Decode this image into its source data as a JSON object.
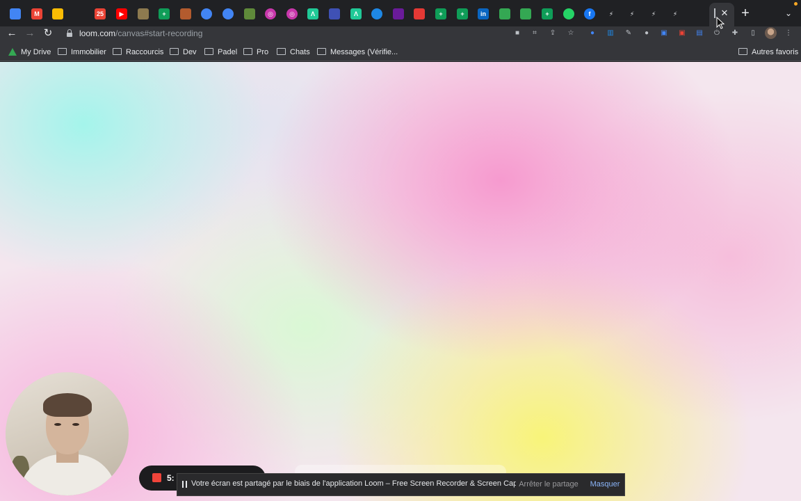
{
  "browser": {
    "tabs": [
      {
        "icon": "maps-pin-icon",
        "color": "#4285f4",
        "glyph": ""
      },
      {
        "icon": "gmail-icon",
        "color": "#ea4335",
        "glyph": "M"
      },
      {
        "icon": "drive-icon",
        "color": "#fbbc04",
        "glyph": ""
      },
      {
        "icon": "notes-icon",
        "color": "#e8eaed",
        "glyph": ""
      },
      {
        "icon": "calendar-icon",
        "color": "#ea4335",
        "glyph": "25"
      },
      {
        "icon": "youtube-icon",
        "color": "#ff0000",
        "glyph": "▶"
      },
      {
        "icon": "tool-icon",
        "color": "#8d7a4f",
        "glyph": ""
      },
      {
        "icon": "sheets-icon",
        "color": "#0f9d58",
        "glyph": "+"
      },
      {
        "icon": "football-icon",
        "color": "#b35b2e",
        "glyph": ""
      },
      {
        "icon": "calendar-blue-icon",
        "color": "#4285f4",
        "glyph": ""
      },
      {
        "icon": "calendar-blue-2-icon",
        "color": "#4285f4",
        "glyph": ""
      },
      {
        "icon": "plant-icon",
        "color": "#5f8a3a",
        "glyph": ""
      },
      {
        "icon": "target-icon",
        "color": "#c837ab",
        "glyph": "◎"
      },
      {
        "icon": "target-2-icon",
        "color": "#c837ab",
        "glyph": "◎"
      },
      {
        "icon": "lambda-icon",
        "color": "#20c997",
        "glyph": "Λ"
      },
      {
        "icon": "blue-app-icon",
        "color": "#3f51b5",
        "glyph": ""
      },
      {
        "icon": "lambda-2-icon",
        "color": "#20c997",
        "glyph": "Λ"
      },
      {
        "icon": "compass-icon",
        "color": "#1e88e5",
        "glyph": ""
      },
      {
        "icon": "stack-icon",
        "color": "#6a1b9a",
        "glyph": ""
      },
      {
        "icon": "red-app-icon",
        "color": "#e53935",
        "glyph": ""
      },
      {
        "icon": "sheets-2-icon",
        "color": "#0f9d58",
        "glyph": "+"
      },
      {
        "icon": "sheets-3-icon",
        "color": "#0f9d58",
        "glyph": "+"
      },
      {
        "icon": "linkedin-icon",
        "color": "#0a66c2",
        "glyph": "in"
      },
      {
        "icon": "maps-icon",
        "color": "#34a853",
        "glyph": ""
      },
      {
        "icon": "maps-2-icon",
        "color": "#34a853",
        "glyph": ""
      },
      {
        "icon": "sheets-4-icon",
        "color": "#0f9d58",
        "glyph": "+"
      },
      {
        "icon": "whatsapp-icon",
        "color": "#25d366",
        "glyph": ""
      },
      {
        "icon": "facebook-icon",
        "color": "#1877f2",
        "glyph": "f"
      },
      {
        "icon": "bolt-icon",
        "color": "#e8eaed",
        "glyph": "⚡"
      },
      {
        "icon": "bolt-2-icon",
        "color": "#e8eaed",
        "glyph": "⚡"
      },
      {
        "icon": "bolt-3-icon",
        "color": "#e8eaed",
        "glyph": "⚡"
      },
      {
        "icon": "bolt-4-icon",
        "color": "#e8eaed",
        "glyph": "⚡"
      },
      {
        "icon": "chrome-icon",
        "color": "#e8eaed",
        "glyph": ""
      }
    ],
    "url_host": "loom.com",
    "url_path": "/canvas#start-recording",
    "bookmarks": [
      {
        "label": "My Drive",
        "type": "drive"
      },
      {
        "label": "Immobilier",
        "type": "folder"
      },
      {
        "label": "Raccourcis",
        "type": "folder"
      },
      {
        "label": "Dev",
        "type": "folder"
      },
      {
        "label": "Padel",
        "type": "folder"
      },
      {
        "label": "Pro",
        "type": "folder"
      },
      {
        "label": "Chats",
        "type": "folder"
      },
      {
        "label": "Messages (Vérifie...",
        "type": "folder"
      }
    ],
    "other_bookmarks": "Autres favoris"
  },
  "loom": {
    "timer": "5:"
  },
  "share_notice": {
    "message": "Votre écran est partagé par le biais de l'application Loom – Free Screen Recorder & Screen Capture.",
    "stop_label": "Arrêter le partage",
    "hide_label": "Masquer"
  }
}
